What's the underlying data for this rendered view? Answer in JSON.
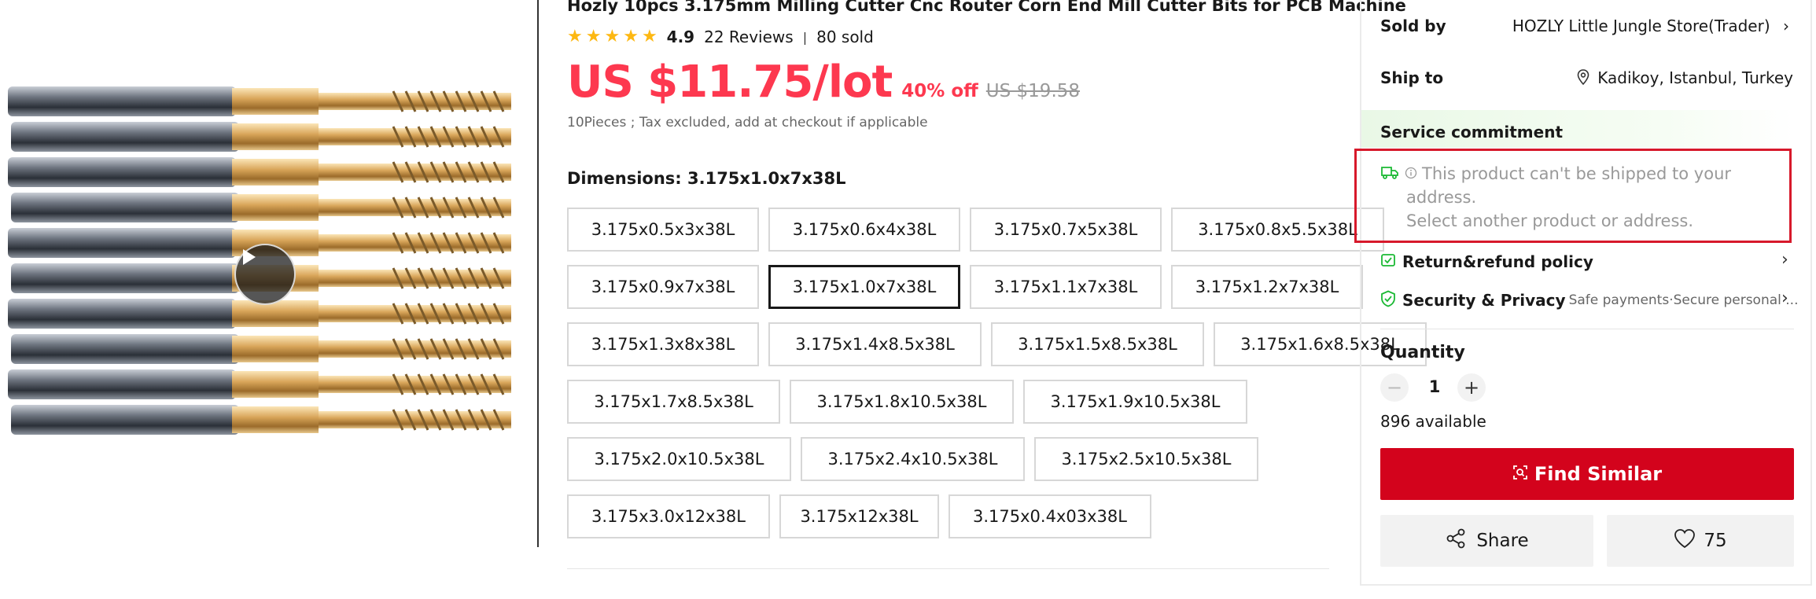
{
  "product": {
    "title": "Hozly 10pcs 3.175mm Milling Cutter Cnc Router Corn End Mill Cutter Bits for PCB Machine",
    "rating": "4.9",
    "reviews": "22 Reviews",
    "sold": "80 sold",
    "price": "US $11.75/lot",
    "discount": "40% off",
    "original_price": "US $19.58",
    "tax_note": "10Pieces ; Tax excluded, add at checkout if applicable",
    "dimensions_label": "Dimensions: 3.175x1.0x7x38L",
    "selected_option": "3.175x1.0x7x38L",
    "options": [
      "3.175x0.5x3x38L",
      "3.175x0.6x4x38L",
      "3.175x0.7x5x38L",
      "3.175x0.8x5.5x38L",
      "3.175x0.9x7x38L",
      "3.175x1.0x7x38L",
      "3.175x1.1x7x38L",
      "3.175x1.2x7x38L",
      "3.175x1.3x8x38L",
      "3.175x1.4x8.5x38L",
      "3.175x1.5x8.5x38L",
      "3.175x1.6x8.5x38L",
      "3.175x1.7x8.5x38L",
      "3.175x1.8x10.5x38L",
      "3.175x1.9x10.5x38L",
      "3.175x2.0x10.5x38L",
      "3.175x2.4x10.5x38L",
      "3.175x2.5x10.5x38L",
      "3.175x3.0x12x38L",
      "3.175x12x38L",
      "3.175x0.4x03x38L"
    ]
  },
  "panel": {
    "sold_by_label": "Sold by",
    "store": "HOZLY Little Jungle Store(Trader)",
    "ship_to_label": "Ship to",
    "ship_to": "Kadikoy, Istanbul, Turkey",
    "service_label": "Service commitment",
    "ship_msg_line1": "This product can't be shipped to your",
    "ship_msg_line2": "address.",
    "ship_msg_line3": "Select another product or address.",
    "return_policy": "Return&refund policy",
    "security_label": "Security & Privacy",
    "security_desc": "Safe payments·Secure personal ...",
    "quantity_label": "Quantity",
    "quantity": "1",
    "available": "896 available",
    "find_similar": "Find Similar",
    "share": "Share",
    "wishlist_count": "75"
  },
  "colors": {
    "price_red": "#fd384f",
    "button_red": "#d3031c",
    "star": "#fdb812",
    "highlight_box": "#d7192b",
    "service_green": "#1bb934"
  },
  "icons": [
    "play-icon",
    "star-icon",
    "chevron-right-icon",
    "location-pin-icon",
    "truck-icon",
    "info-icon",
    "return-icon",
    "shield-check-icon",
    "minus-icon",
    "plus-icon",
    "find-similar-icon",
    "share-icon",
    "heart-icon"
  ]
}
